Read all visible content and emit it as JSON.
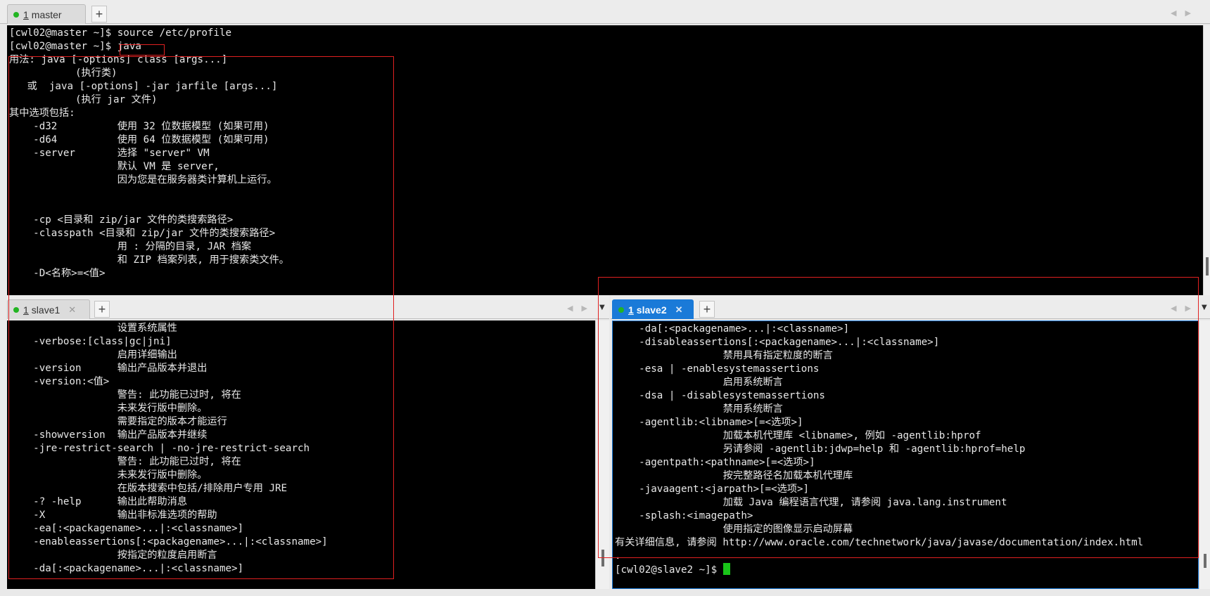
{
  "master": {
    "tab": {
      "number": "1",
      "label": "master"
    },
    "lines": [
      "[cwl02@master ~]$ source /etc/profile",
      "[cwl02@master ~]$ java",
      "用法: java [-options] class [args...]",
      "           (执行类)",
      "   或  java [-options] -jar jarfile [args...]",
      "           (执行 jar 文件)",
      "其中选项包括:",
      "    -d32          使用 32 位数据模型 (如果可用)",
      "    -d64          使用 64 位数据模型 (如果可用)",
      "    -server       选择 \"server\" VM",
      "                  默认 VM 是 server,",
      "                  因为您是在服务器类计算机上运行。",
      "",
      "",
      "    -cp <目录和 zip/jar 文件的类搜索路径>",
      "    -classpath <目录和 zip/jar 文件的类搜索路径>",
      "                  用 : 分隔的目录, JAR 档案",
      "                  和 ZIP 档案列表, 用于搜索类文件。",
      "    -D<名称>=<值>"
    ]
  },
  "slave1": {
    "tab": {
      "number": "1",
      "label": "slave1"
    },
    "lines": [
      "                  设置系统属性",
      "    -verbose:[class|gc|jni]",
      "                  启用详细输出",
      "    -version      输出产品版本并退出",
      "    -version:<值>",
      "                  警告: 此功能已过时, 将在",
      "                  未来发行版中删除。",
      "                  需要指定的版本才能运行",
      "    -showversion  输出产品版本并继续",
      "    -jre-restrict-search | -no-jre-restrict-search",
      "                  警告: 此功能已过时, 将在",
      "                  未来发行版中删除。",
      "                  在版本搜索中包括/排除用户专用 JRE",
      "    -? -help      输出此帮助消息",
      "    -X            输出非标准选项的帮助",
      "    -ea[:<packagename>...|:<classname>]",
      "    -enableassertions[:<packagename>...|:<classname>]",
      "                  按指定的粒度启用断言",
      "    -da[:<packagename>...|:<classname>]"
    ]
  },
  "slave2": {
    "tab": {
      "number": "1",
      "label": "slave2"
    },
    "lines": [
      "    -da[:<packagename>...|:<classname>]",
      "    -disableassertions[:<packagename>...|:<classname>]",
      "                  禁用具有指定粒度的断言",
      "    -esa | -enablesystemassertions",
      "                  启用系统断言",
      "    -dsa | -disablesystemassertions",
      "                  禁用系统断言",
      "    -agentlib:<libname>[=<选项>]",
      "                  加载本机代理库 <libname>, 例如 -agentlib:hprof",
      "                  另请参阅 -agentlib:jdwp=help 和 -agentlib:hprof=help",
      "    -agentpath:<pathname>[=<选项>]",
      "                  按完整路径名加载本机代理库",
      "    -javaagent:<jarpath>[=<选项>]",
      "                  加载 Java 编程语言代理, 请参阅 java.lang.instrument",
      "    -splash:<imagepath>",
      "                  使用指定的图像显示启动屏幕",
      "有关详细信息, 请参阅 http://www.oracle.com/technetwork/java/javase/documentation/index.html",
      ".",
      "[cwl02@slave2 ~]$ "
    ]
  },
  "icons": {
    "new_tab": "+",
    "close_tab": "✕",
    "prev_arrow": "◀",
    "next_arrow": "▶",
    "dropdown": "▼"
  },
  "colors": {
    "terminal_bg": "#000000",
    "terminal_fg": "#e8e8e8",
    "active_tab": "#1a7ad8",
    "status_dot": "#23b523",
    "cursor": "#19c419",
    "highlight_box": "#e02020"
  }
}
